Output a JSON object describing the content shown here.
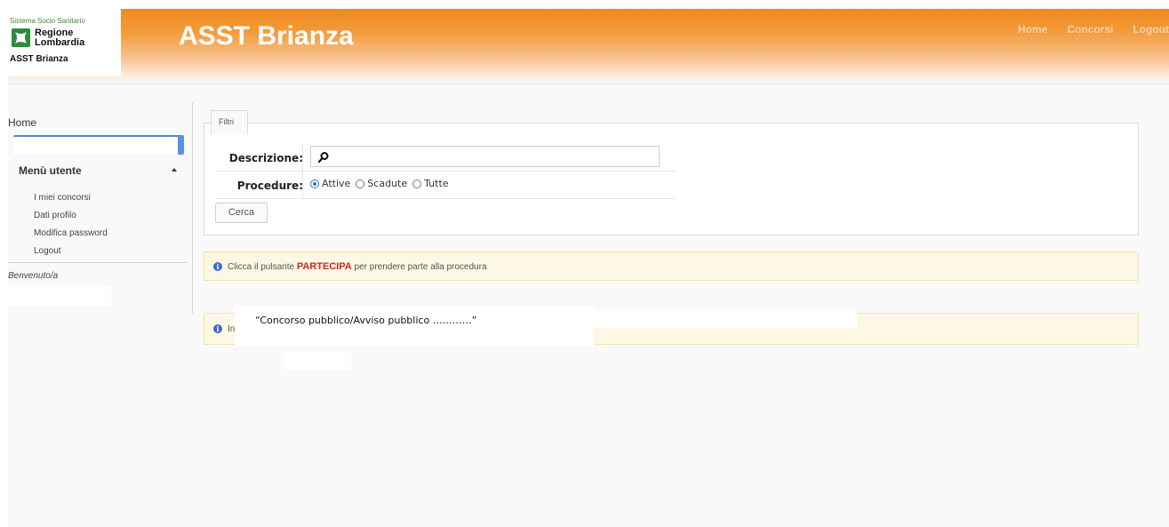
{
  "logo": {
    "tagline": "Sistema Socio Sanitario",
    "region_line1": "Regione",
    "region_line2": "Lombardia",
    "org": "ASST Brianza",
    "brand_color": "#2e8b3d"
  },
  "header": {
    "title": "ASST Brianza",
    "nav": [
      "Home",
      "Concorsi",
      "Logout"
    ],
    "accent_color": "#f08a1c"
  },
  "sidebar": {
    "home_label": "Home",
    "section_label": "Menù utente",
    "items": [
      "I miei concorsi",
      "Dati profilo",
      "Modifica password",
      "Logout"
    ],
    "welcome": "Benvenuto/a"
  },
  "filters": {
    "legend": "Filtri",
    "description_label": "Descrizione:",
    "description_value": "",
    "procedure_label": "Procedure:",
    "procedure_options": [
      "Attive",
      "Scadute",
      "Tutte"
    ],
    "procedure_selected": "Attive",
    "search_button": "Cerca"
  },
  "alerts": {
    "info1_before": "Clicca il pulsante ",
    "info1_strong": "PARTECIPA",
    "info1_after": " per prendere parte alla procedura",
    "info2_prefix": "In",
    "overlay_text": "“Concorso pubblico/Avviso pubblico …………”"
  }
}
